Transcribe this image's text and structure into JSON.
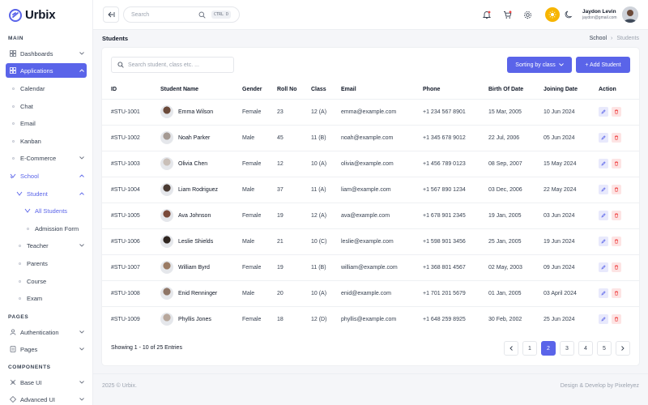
{
  "brand": {
    "name": "Urbix"
  },
  "sidebar": {
    "sections": {
      "main": "MAIN",
      "pages": "PAGES",
      "components": "COMPONENTS"
    },
    "items": [
      {
        "label": "Dashboards"
      },
      {
        "label": "Applications"
      },
      {
        "label": "Calendar"
      },
      {
        "label": "Chat"
      },
      {
        "label": "Email"
      },
      {
        "label": "Kanban"
      },
      {
        "label": "E-Commerce"
      },
      {
        "label": "School"
      },
      {
        "label": "Student"
      },
      {
        "label": "All Students"
      },
      {
        "label": "Admission Form"
      },
      {
        "label": "Teacher"
      },
      {
        "label": "Parents"
      },
      {
        "label": "Course"
      },
      {
        "label": "Exam"
      },
      {
        "label": "Authentication"
      },
      {
        "label": "Pages"
      },
      {
        "label": "Base UI"
      },
      {
        "label": "Advanced UI"
      }
    ]
  },
  "topbar": {
    "search_placeholder": "Search",
    "shortcut": "CTRL D",
    "user_name": "Jaydon Levin",
    "user_email": "jaydon@gmail.com"
  },
  "page": {
    "title": "Students",
    "breadcrumb": [
      "School",
      "Students"
    ]
  },
  "toolbar": {
    "search_placeholder": "Search student, class etc. ...",
    "sort_label": "Sorting by class",
    "add_label": "+ Add Student"
  },
  "table": {
    "headers": [
      "ID",
      "Student Name",
      "Gender",
      "Roll No",
      "Class",
      "Email",
      "Phone",
      "Birth Of Date",
      "Joining Date",
      "Action"
    ],
    "rows": [
      [
        "#STU-1001",
        "Emma Wilson",
        "Female",
        "23",
        "12 (A)",
        "emma@example.com",
        "+1 234 567 8901",
        "15 Mar, 2005",
        "10 Jun 2024"
      ],
      [
        "#STU-1002",
        "Noah Parker",
        "Male",
        "45",
        "11 (B)",
        "noah@example.com",
        "+1 345 678 9012",
        "22 Jul, 2006",
        "05 Jun 2024"
      ],
      [
        "#STU-1003",
        "Olivia Chen",
        "Female",
        "12",
        "10 (A)",
        "olivia@example.com",
        "+1 456 789 0123",
        "08 Sep, 2007",
        "15 May 2024"
      ],
      [
        "#STU-1004",
        "Liam Rodriguez",
        "Male",
        "37",
        "11 (A)",
        "liam@example.com",
        "+1 567 890 1234",
        "03 Dec, 2006",
        "22 May 2024"
      ],
      [
        "#STU-1005",
        "Ava Johnson",
        "Female",
        "19",
        "12 (A)",
        "ava@example.com",
        "+1 678 901 2345",
        "19 Jan, 2005",
        "03 Jun 2024"
      ],
      [
        "#STU-1006",
        "Leslie Shields",
        "Male",
        "21",
        "10 (C)",
        "leslie@example.com",
        "+1 598 901 3456",
        "25 Jan, 2005",
        "19 Jun 2024"
      ],
      [
        "#STU-1007",
        "William Byrd",
        "Female",
        "19",
        "11 (B)",
        "william@example.com",
        "+1 368 801 4567",
        "02 May, 2003",
        "09 Jun 2024"
      ],
      [
        "#STU-1008",
        "Enid Renninger",
        "Male",
        "20",
        "10 (A)",
        "enid@example.com",
        "+1 701 201 5679",
        "01 Jan, 2005",
        "03 April 2024"
      ],
      [
        "#STU-1009",
        "Phyllis Jones",
        "Female",
        "18",
        "12 (D)",
        "phyllis@example.com",
        "+1 648 259 8925",
        "30 Feb, 2002",
        "25 Jun 2024"
      ]
    ],
    "avatar_colors": [
      "#6b4a3a",
      "#a59a93",
      "#c9bfb8",
      "#4a3b33",
      "#7a4a3a",
      "#2f2620",
      "#9a7b64",
      "#8e7566",
      "#b7a79b"
    ]
  },
  "pagination": {
    "summary": "Showing 1 - 10 of 25 Entries",
    "pages": [
      "1",
      "2",
      "3",
      "4",
      "5"
    ],
    "active_page": "2"
  },
  "footer": {
    "left": "2025 © Urbix.",
    "right": "Design & Develop by Pixeleyez"
  },
  "colors": {
    "accent": "#5a64e9",
    "danger": "#ef4444",
    "sun": "#f7b500"
  }
}
